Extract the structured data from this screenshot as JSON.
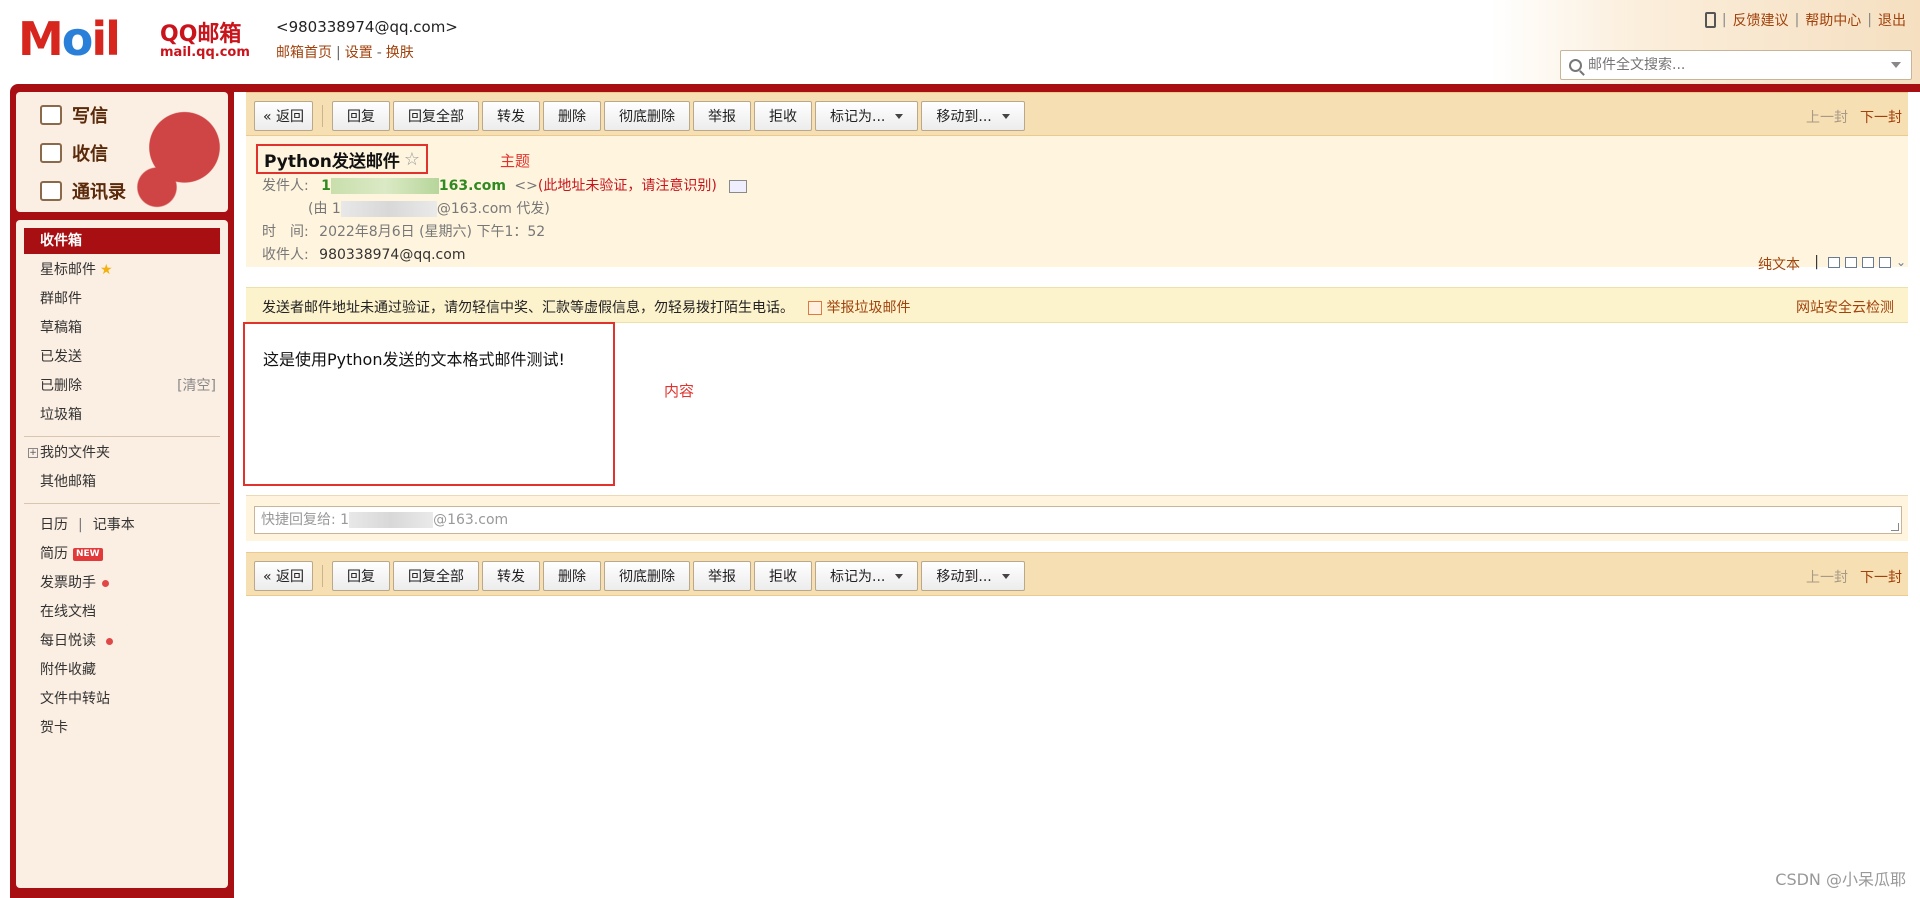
{
  "header": {
    "logo_text": "MOil",
    "logo_brand": "QQ邮箱",
    "logo_url": "mail.qq.com",
    "account": "<980338974@qq.com>",
    "links": [
      "邮箱首页",
      "设置",
      "换肤"
    ],
    "top_links": [
      "反馈建议",
      "帮助中心",
      "退出"
    ],
    "search_placeholder": "邮件全文搜索..."
  },
  "sidebar": {
    "compose": [
      "写信",
      "收信",
      "通讯录"
    ],
    "folders": [
      {
        "label": "收件箱",
        "active": true
      },
      {
        "label": "星标邮件",
        "star": true
      },
      {
        "label": "群邮件"
      },
      {
        "label": "草稿箱"
      },
      {
        "label": "已发送"
      },
      {
        "label": "已删除",
        "extra": "[清空]"
      },
      {
        "label": "垃圾箱"
      }
    ],
    "my_folders": "我的文件夹",
    "other_mailbox": "其他邮箱",
    "calendar": "日历",
    "notebook": "记事本",
    "apps": [
      {
        "label": "简历",
        "badge": "NEW"
      },
      {
        "label": "发票助手",
        "dot": true
      },
      {
        "label": "在线文档"
      },
      {
        "label": "每日悦读",
        "dot": true
      },
      {
        "label": "附件收藏"
      },
      {
        "label": "文件中转站"
      },
      {
        "label": "贺卡"
      }
    ]
  },
  "toolbar": {
    "back": "« 返回",
    "reply": "回复",
    "reply_all": "回复全部",
    "forward": "转发",
    "delete": "删除",
    "delete_permanent": "彻底删除",
    "report": "举报",
    "reject": "拒收",
    "mark_as": "标记为...",
    "move_to": "移动到...",
    "prev": "上一封",
    "next": "下一封"
  },
  "mail": {
    "subject": "Python发送邮件",
    "subject_annotation": "主题",
    "from_label": "发件人:",
    "from_prefix": "1",
    "from_suffix": "163.com",
    "from_extra": "<>",
    "unverified_note": "(此地址未验证，请注意识别)",
    "via_prefix": "(由 1",
    "via_suffix": "@163.com 代发)",
    "time_label": "时　间:",
    "time": "2022年8月6日 (星期六) 下午1：52",
    "to_label": "收件人:",
    "to": "980338974@qq.com",
    "plain_text": "纯文本",
    "warning": "发送者邮件地址未通过验证，请勿轻信中奖、汇款等虚假信息，勿轻易拨打陌生电话。",
    "report_spam": "举报垃圾邮件",
    "security_check": "网站安全云检测",
    "body": "这是使用Python发送的文本格式邮件测试!",
    "body_annotation": "内容",
    "quick_reply_prefix": "快捷回复给: 1",
    "quick_reply_suffix": "@163.com"
  },
  "watermark": "CSDN @小呆瓜耶"
}
